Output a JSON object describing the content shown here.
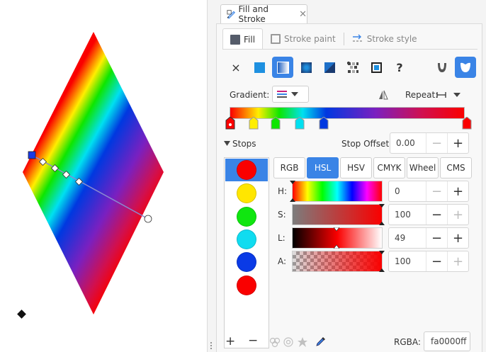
{
  "dialog": {
    "tab_title": "Fill and Stroke",
    "tab_icon": "fill-stroke-icon",
    "tabs": [
      {
        "label": "Fill",
        "icon": "fill-square-icon"
      },
      {
        "label": "Stroke paint",
        "icon": "stroke-square-icon"
      },
      {
        "label": "Stroke style",
        "icon": "stroke-style-icon"
      }
    ]
  },
  "paint_types": [
    {
      "name": "no-paint",
      "glyph": "×"
    },
    {
      "name": "flat-color",
      "color": "#1e90e0"
    },
    {
      "name": "linear-gradient",
      "selected": true
    },
    {
      "name": "radial-gradient"
    },
    {
      "name": "mesh-gradient"
    },
    {
      "name": "pattern"
    },
    {
      "name": "swatch"
    },
    {
      "name": "unset",
      "glyph": "?"
    }
  ],
  "gradient": {
    "label": "Gradient:",
    "repeat_label": "Repeat:",
    "stops": [
      "#fa0000",
      "#ffee00",
      "#0ee600",
      "#00e0f0",
      "#0038e0",
      "#fa0000"
    ]
  },
  "stops_section": {
    "label": "Stops",
    "offset_label": "Stop Offset:",
    "offset_value": "0.00",
    "swatches": [
      "#fa0000",
      "#ffe600",
      "#10e610",
      "#10dcf0",
      "#0a3ae6",
      "#fa0000"
    ]
  },
  "color_modes": [
    "RGB",
    "HSL",
    "HSV",
    "CMYK",
    "Wheel",
    "CMS"
  ],
  "selected_mode": "HSL",
  "hsl": [
    {
      "label": "H:",
      "value": "0"
    },
    {
      "label": "S:",
      "value": "100"
    },
    {
      "label": "L:",
      "value": "49"
    },
    {
      "label": "A:",
      "value": "100"
    }
  ],
  "rgba": {
    "label": "RGBA:",
    "value": "fa0000ff"
  },
  "colors": {
    "accent": "#3a84e6"
  }
}
